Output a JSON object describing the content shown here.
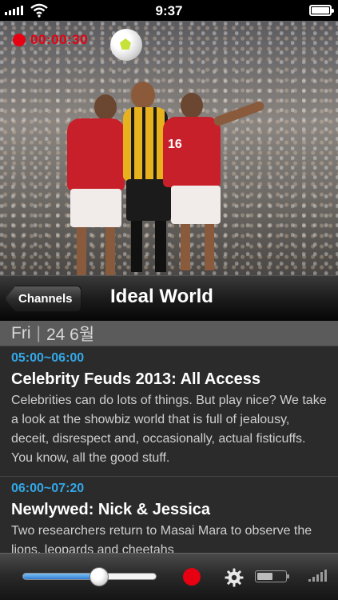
{
  "status_bar": {
    "time": "9:37"
  },
  "video": {
    "recording_time": "00:00:30",
    "jersey_number": "16"
  },
  "header": {
    "back_label": "Channels",
    "title": "Ideal World"
  },
  "date_bar": {
    "day": "Fri",
    "date": "24 6월"
  },
  "programs": [
    {
      "time": "05:00~06:00",
      "title": "Celebrity Feuds 2013: All Access",
      "description": "Celebrities can do lots of things. But play nice? We take a look at the showbiz world that is full of jealousy, deceit, disrespect and, occasionally, actual fisticuffs. You know, all the good stuff."
    },
    {
      "time": "06:00~07:20",
      "title": "Newlywed: Nick & Jessica",
      "description": "Two researchers return to Masai Mara to observe the lions, leopards and cheetahs"
    }
  ],
  "toolbar": {
    "volume_level": 0.57
  },
  "colors": {
    "record_red": "#e60012",
    "time_blue": "#33a8e8",
    "accent_slider": "#2f7ed4"
  },
  "icons": [
    "signal-icon",
    "wifi-icon",
    "battery-icon",
    "record-icon",
    "soccer-ball-icon",
    "back-arrow-icon",
    "gear-icon",
    "signal-strength-icon"
  ]
}
